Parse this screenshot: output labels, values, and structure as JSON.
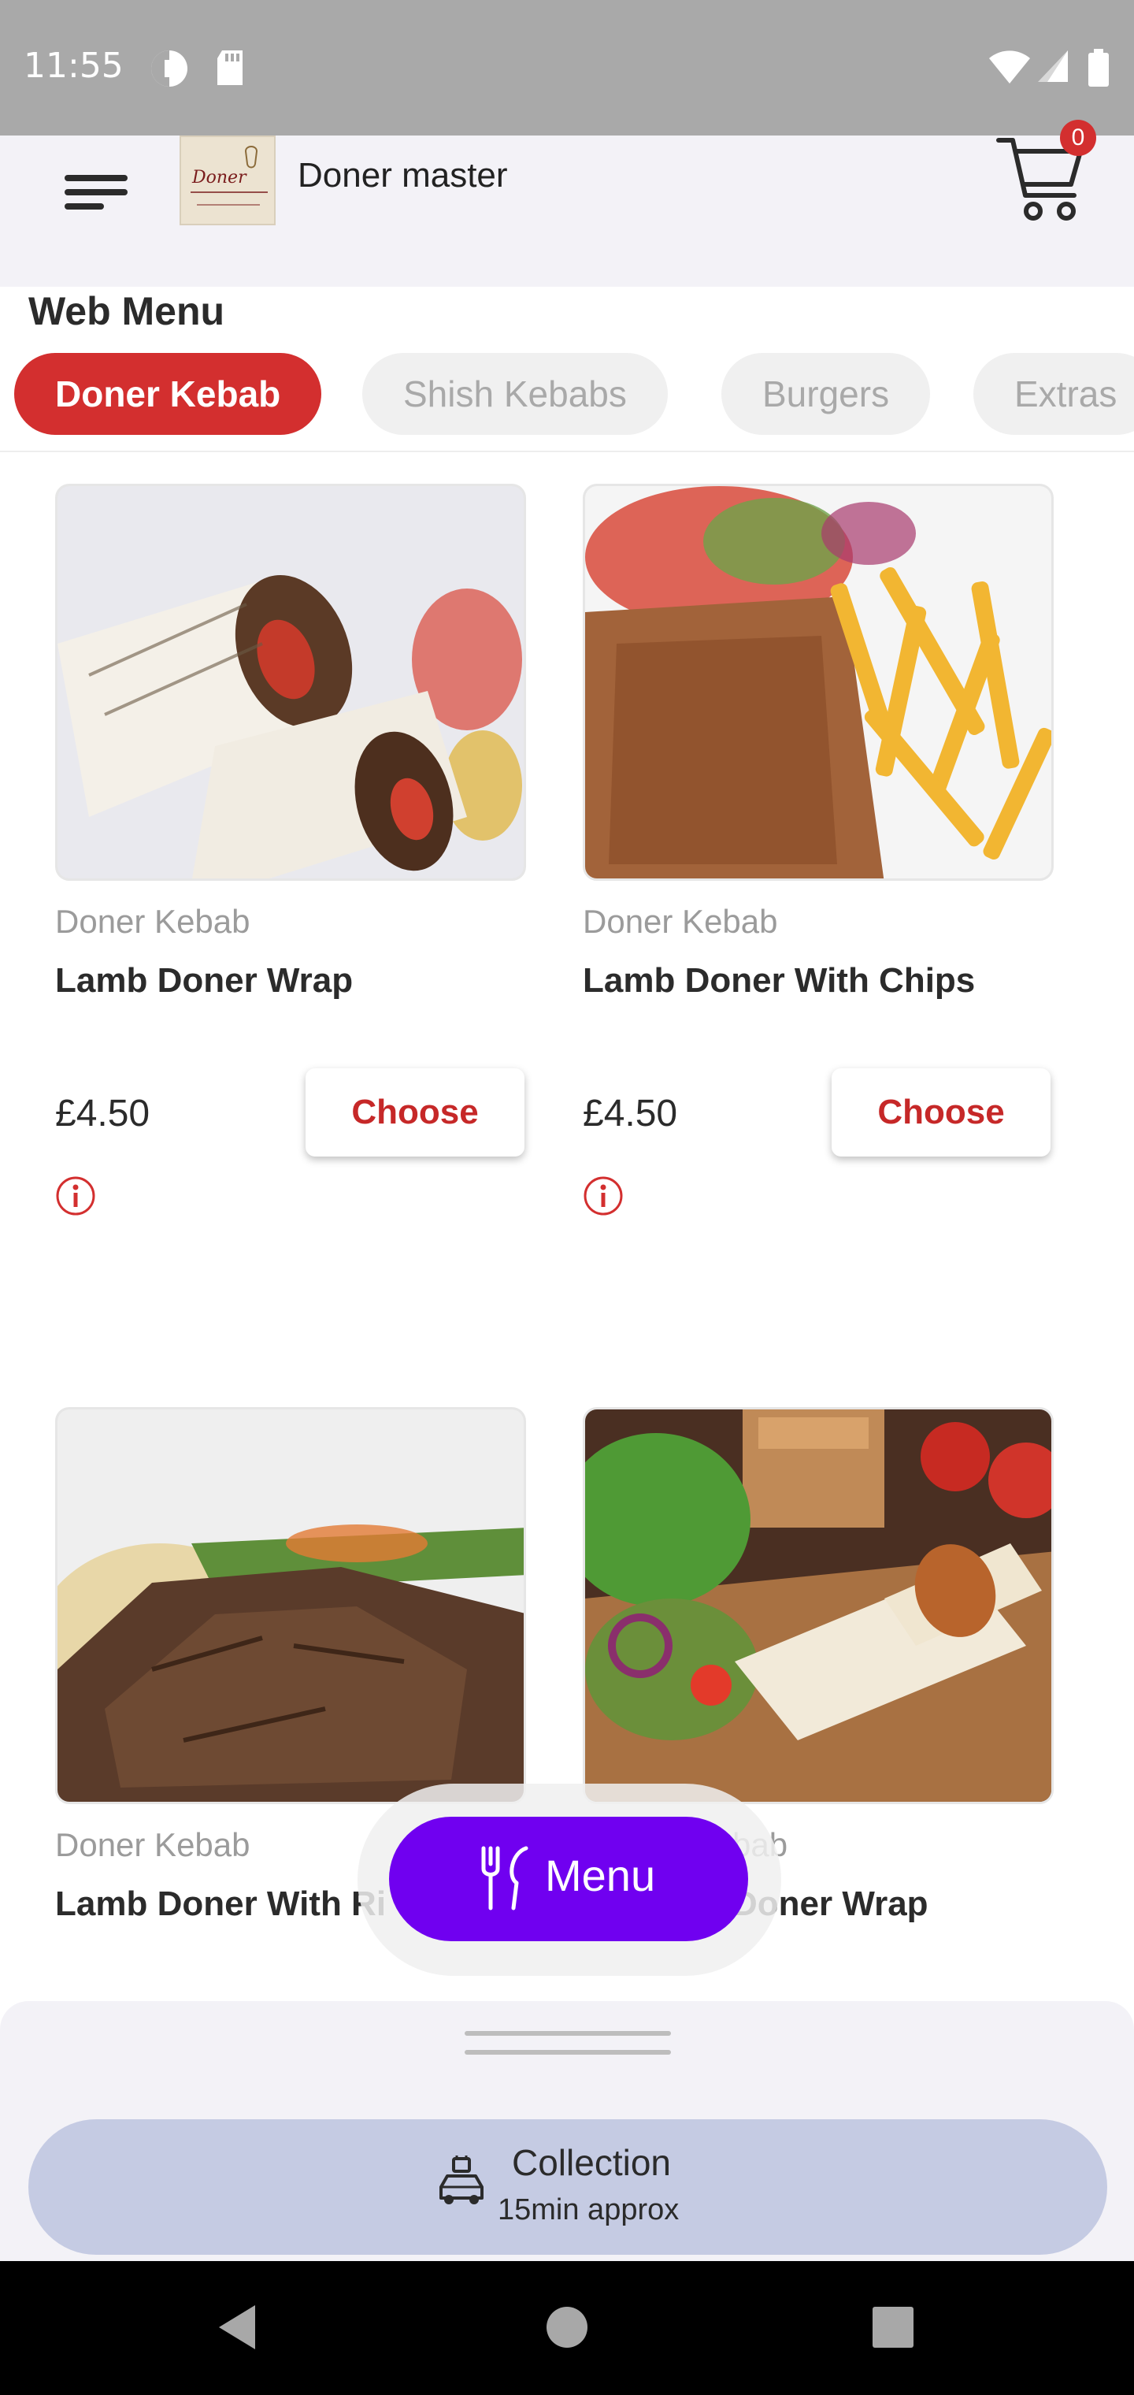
{
  "status_bar": {
    "time": "11:55"
  },
  "header": {
    "store_name": "Doner master",
    "cart_count": "0",
    "logo_text": "Doner"
  },
  "menu": {
    "title": "Web Menu",
    "categories": [
      {
        "label": "Doner Kebab",
        "active": true
      },
      {
        "label": "Shish Kebabs",
        "active": false
      },
      {
        "label": "Burgers",
        "active": false
      },
      {
        "label": "Extras",
        "active": false
      }
    ]
  },
  "products": [
    {
      "category": "Doner Kebab",
      "name": "Lamb Doner Wrap",
      "price": "£4.50",
      "choose_label": "Choose"
    },
    {
      "category": "Doner Kebab",
      "name": "Lamb Doner With Chips",
      "price": "£4.50",
      "choose_label": "Choose"
    },
    {
      "category": "Doner Kebab",
      "name": "Lamb Doner With Ri"
    },
    {
      "category": "bab",
      "name": "Doner Wrap"
    }
  ],
  "fab": {
    "label": "Menu"
  },
  "bottom_sheet": {
    "mode_title": "Collection",
    "mode_subtitle": "15min approx"
  },
  "colors": {
    "accent_red": "#d32f2f",
    "fab_purple": "#7000f0",
    "sheet_bg": "#f3f2f7",
    "collection_bg": "#c5cbe3"
  }
}
